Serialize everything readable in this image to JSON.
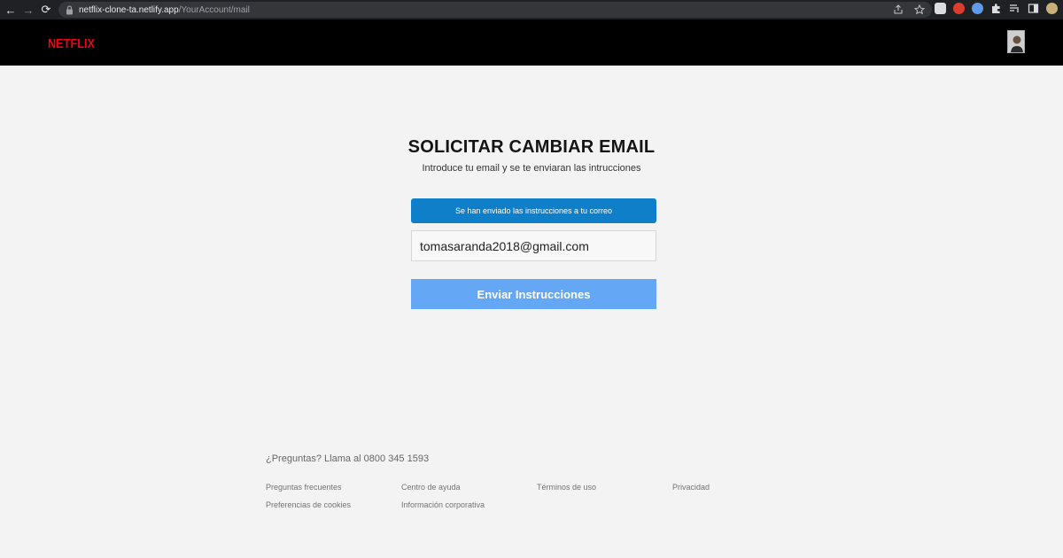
{
  "browser": {
    "url_host": "netflix-clone-ta.netlify.app",
    "url_path": "/YourAccount/mail"
  },
  "header": {
    "logo_text": "NETFLIX",
    "brand_color": "#e50914"
  },
  "main": {
    "title": "SOLICITAR CAMBIAR EMAIL",
    "subtitle": "Introduce tu email y se te enviaran las intrucciones",
    "alert_text": "Se han enviado las instrucciones a tu correo",
    "email_value": "tomasaranda2018@gmail.com",
    "submit_label": "Enviar Instrucciones",
    "alert_color": "#0e7fc8",
    "button_color": "#64a7f5"
  },
  "footer": {
    "phone_text": "¿Preguntas? Llama al 0800 345 1593",
    "links": [
      "Preguntas frecuentes",
      "Centro de ayuda",
      "Términos de uso",
      "Privacidad",
      "Preferencias de cookies",
      "Información corporativa"
    ]
  }
}
